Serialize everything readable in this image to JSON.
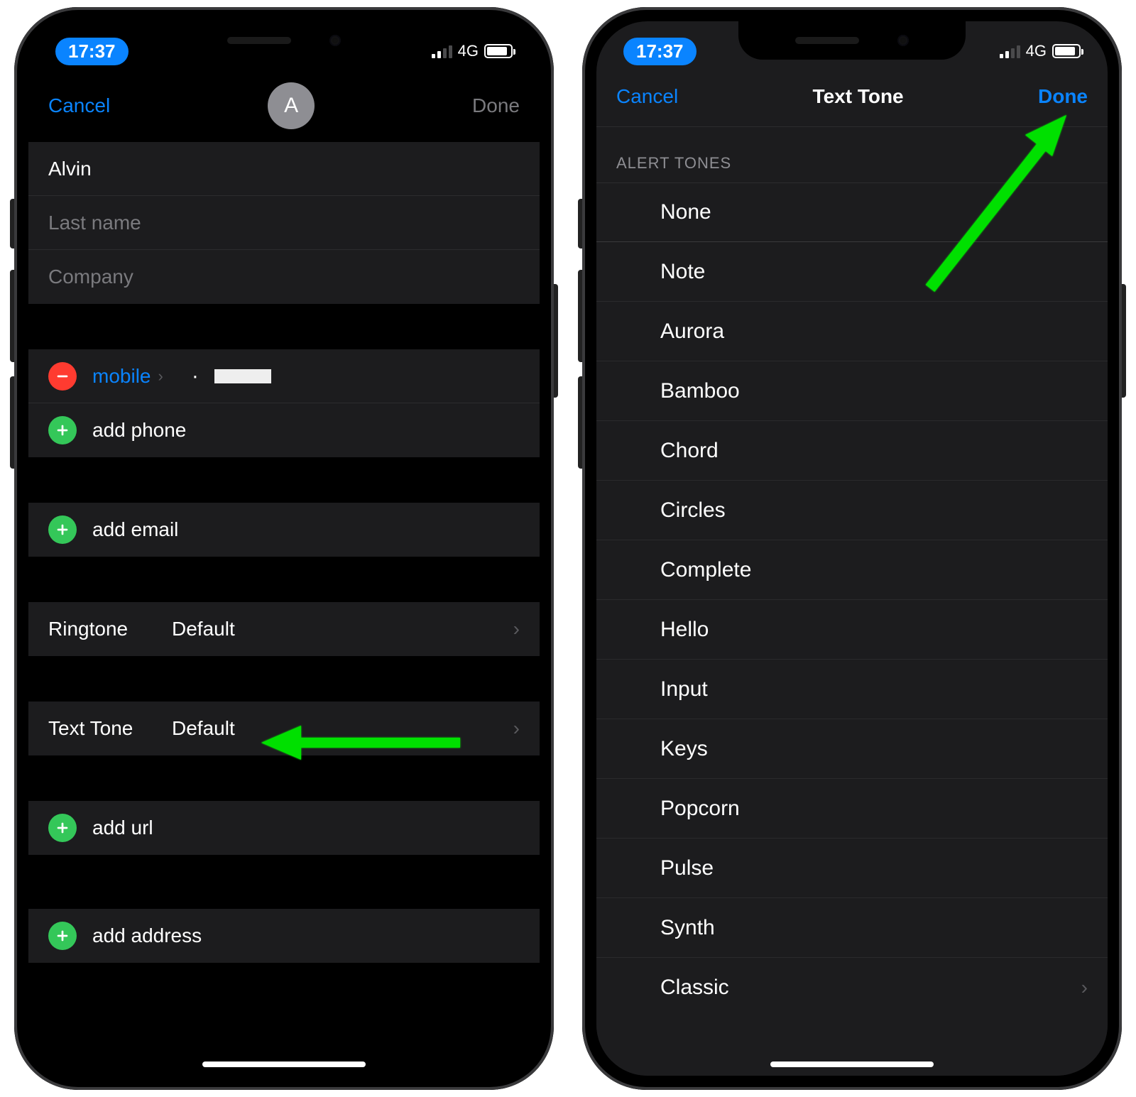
{
  "status": {
    "time": "17:37",
    "network": "4G"
  },
  "left": {
    "nav_cancel": "Cancel",
    "nav_done": "Done",
    "avatar_letter": "A",
    "first_name": "Alvin",
    "last_name_ph": "Last name",
    "company_ph": "Company",
    "phone_type": "mobile",
    "add_phone": "add phone",
    "add_email": "add email",
    "ringtone_label": "Ringtone",
    "ringtone_value": "Default",
    "texttone_label": "Text Tone",
    "texttone_value": "Default",
    "add_url": "add url",
    "add_address": "add address"
  },
  "right": {
    "nav_cancel": "Cancel",
    "nav_title": "Text Tone",
    "nav_done": "Done",
    "section_header": "ALERT TONES",
    "tones": [
      "None",
      "Note",
      "Aurora",
      "Bamboo",
      "Chord",
      "Circles",
      "Complete",
      "Hello",
      "Input",
      "Keys",
      "Popcorn",
      "Pulse",
      "Synth",
      "Classic"
    ]
  }
}
